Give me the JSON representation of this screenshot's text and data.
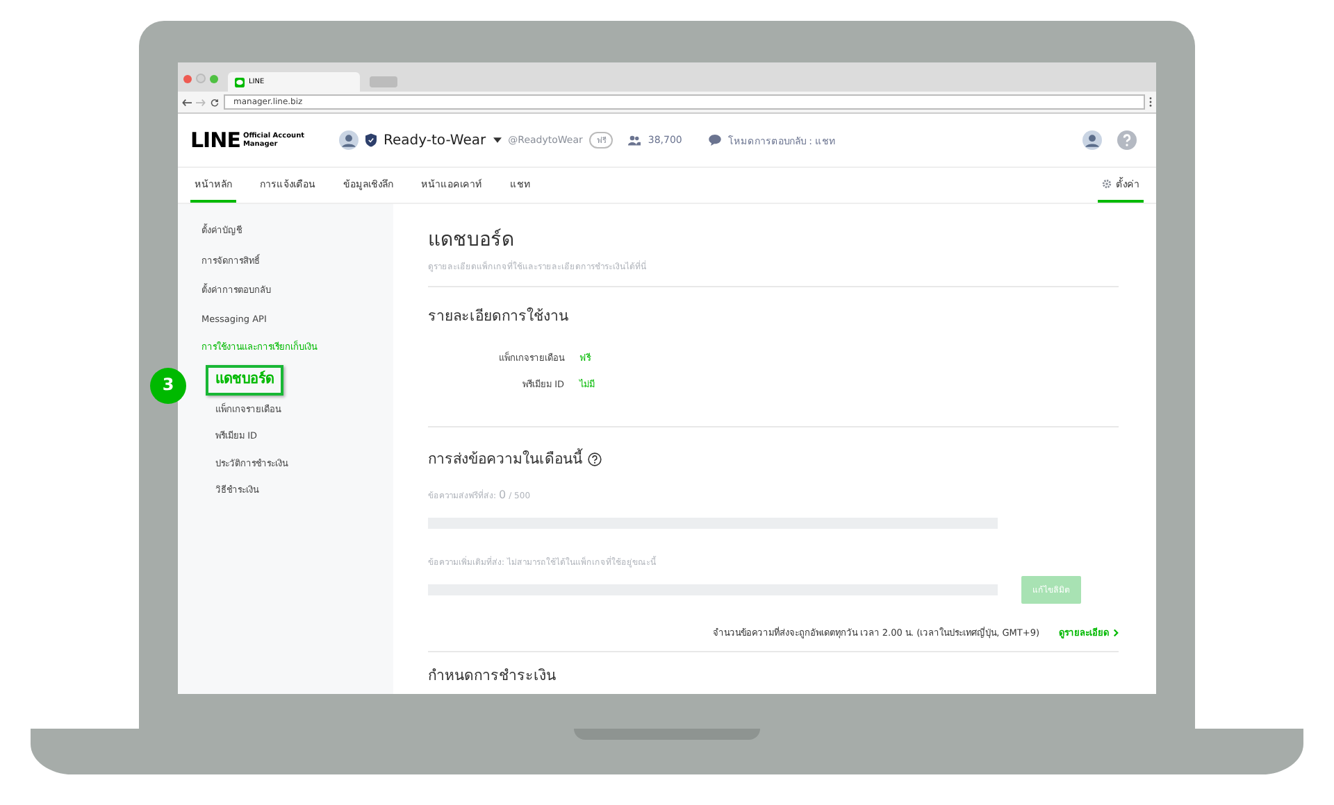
{
  "browser": {
    "tab_title": "LINE",
    "url": "manager.line.biz"
  },
  "header": {
    "logo": {
      "wordmark": "LINE",
      "lines": [
        "Official Account",
        "Manager"
      ]
    },
    "account_name": "Ready-to-Wear",
    "handle": "@ReadytoWear",
    "plan_badge": "ฟรี",
    "friends": "38,700",
    "reply_mode": "โหมดการตอบกลับ : แชท"
  },
  "nav": {
    "items": [
      {
        "label": "หน้าหลัก",
        "selected": true
      },
      {
        "label": "การแจ้งเตือน",
        "selected": false
      },
      {
        "label": "ข้อมูลเชิงลึก",
        "selected": false
      },
      {
        "label": "หน้าแอคเคาท์",
        "selected": false
      },
      {
        "label": "แชท",
        "selected": false
      }
    ],
    "settings": {
      "label": "ตั้งค่า",
      "selected": true
    }
  },
  "sidebar": {
    "items": [
      {
        "label": "ตั้งค่าบัญชี",
        "selected": false
      },
      {
        "label": "การจัดการสิทธิ์",
        "selected": false
      },
      {
        "label": "ตั้งค่าการตอบกลับ",
        "selected": false
      },
      {
        "label": "Messaging API",
        "selected": false
      },
      {
        "label": "การใช้งานและการเรียกเก็บเงิน",
        "selected": true,
        "children": [
          {
            "label": "แดชบอร์ด",
            "selected": true,
            "callout": "3"
          },
          {
            "label": "แพ็กเกจรายเดือน",
            "selected": false
          },
          {
            "label": "พรีเมียม ID",
            "selected": false
          },
          {
            "label": "ประวัติการชำระเงิน",
            "selected": false
          },
          {
            "label": "วิธีชำระเงิน",
            "selected": false
          }
        ]
      }
    ]
  },
  "main": {
    "title": "แดชบอร์ด",
    "subtitle": "ดูรายละเอียดแพ็กเกจที่ใช้และรายละเอียดการชำระเงินได้ที่นี่",
    "usage": {
      "heading": "รายละเอียดการใช้งาน",
      "rows": [
        {
          "label": "แพ็กเกจรายเดือน",
          "value": "ฟรี"
        },
        {
          "label": "พรีเมียม ID",
          "value": "ไม่มี"
        }
      ]
    },
    "messages": {
      "heading": "การส่งข้อความในเดือนนี้",
      "free": {
        "label": "ข้อความส่งฟรีที่ส่ง:",
        "count": "0",
        "limit": "/ 500",
        "level": 0
      },
      "extra": {
        "label": "ข้อความเพิ่มเติมที่ส่ง: ไม่สามารถใช้ได้ในแพ็กเกจที่ใช้อยู่ขณะนี้",
        "level": 0,
        "button": {
          "label": "แก้ไขลิมิต",
          "disabled": true
        }
      },
      "note": "จำนวนข้อความที่ส่งจะถูกอัพเดตทุกวัน เวลา 2.00 น. (เวลาในประเทศญี่ปุ่น, GMT+9)",
      "link": "ดูรายละเอียด"
    },
    "next_heading": "กำหนดการชำระเงิน"
  }
}
